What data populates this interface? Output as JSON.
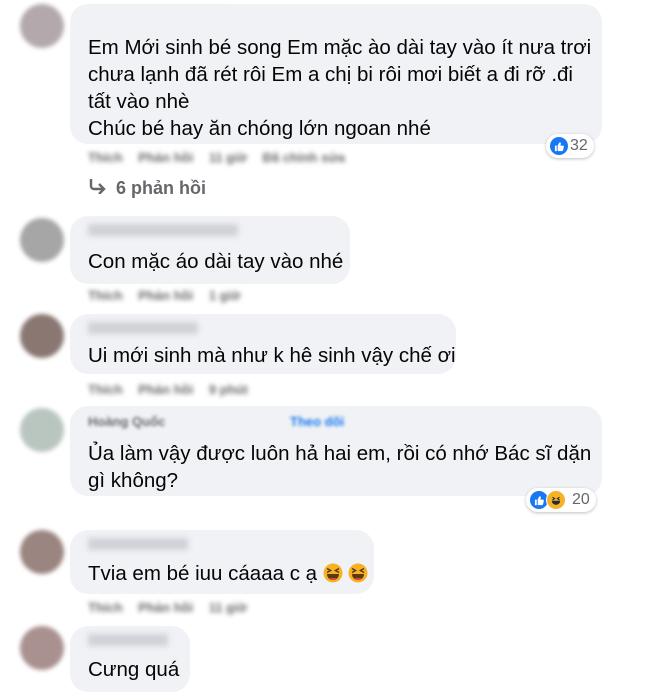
{
  "comments": [
    {
      "text": "Em Mới sinh bé song Em mặc ào dài tay vào ít nưa trơi\nchưa lạnh đã rét rôi Em a chị bi rôi mơi biết a đi rỡ .đi\ntất vào nhè\nChúc bé hay ăn chóng lớn ngoan nhé",
      "actions": [
        "Thích",
        "Phản hồi",
        "11 giờ",
        "Đã chỉnh sửa"
      ],
      "reaction_count": "32",
      "reaction_icons": [
        "like-icon"
      ]
    },
    {
      "text": "Con mặc áo dài tay vào nhé",
      "actions": [
        "Thích",
        "Phản hồi",
        "1 giờ"
      ]
    },
    {
      "text": "Ui mới sinh mà như k hê sinh vậy chế ơi",
      "actions": [
        "Thích",
        "Phản hồi",
        "9 phút"
      ]
    },
    {
      "name": "Hoàng Quốc",
      "follow": "Theo dõi",
      "text": "Ủa làm vậy được luôn hả hai em, rồi có nhớ Bác sĩ dặn\ngì không?",
      "reaction_count": "20",
      "reaction_icons": [
        "like-icon",
        "haha-icon"
      ]
    },
    {
      "text": "Tvia em bé iuu cáaaa c ạ",
      "actions": [
        "Thích",
        "Phản hồi",
        "11 giờ"
      ],
      "emoji": [
        "squinting-laugh-emoji",
        "squinting-laugh-emoji"
      ]
    },
    {
      "text": "Cưng quá"
    }
  ],
  "replies_link": "6 phản hồi",
  "colors": {
    "bubble": "#f0f2f5",
    "like_blue": "#1877f2",
    "haha_yellow": "#f7b125",
    "meta_gray": "#65676b"
  }
}
